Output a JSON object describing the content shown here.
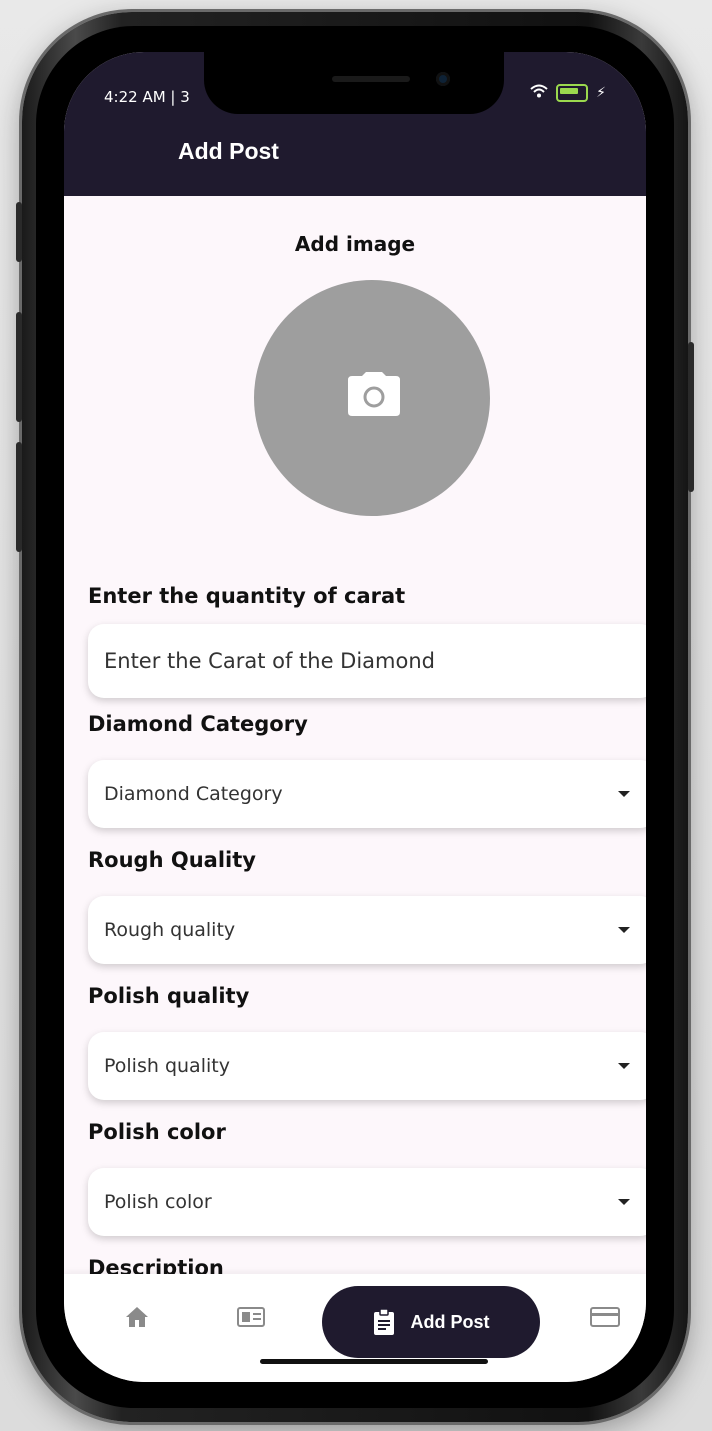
{
  "status_bar": {
    "time": "4:22 AM | 3"
  },
  "app_bar": {
    "title": "Add Post"
  },
  "form": {
    "add_image_label": "Add image",
    "carat": {
      "label": "Enter the quantity of carat",
      "placeholder": "Enter the Carat of the Diamond"
    },
    "category": {
      "label": "Diamond Category",
      "value": "Diamond Category"
    },
    "rough_quality": {
      "label": "Rough Quality",
      "value": "Rough quality"
    },
    "polish_quality": {
      "label": "Polish quality",
      "value": "Polish quality"
    },
    "polish_color": {
      "label": "Polish color",
      "value": "Polish color"
    },
    "description": {
      "label": "Description"
    }
  },
  "bottom_nav": {
    "items": [
      {
        "icon": "home-icon"
      },
      {
        "icon": "id-card-icon"
      },
      {
        "icon": "clipboard-icon",
        "label": "Add Post",
        "active": true
      },
      {
        "icon": "card-icon"
      }
    ]
  },
  "colors": {
    "primary_dark": "#1f1a2e",
    "screen_bg": "#fdf7fb",
    "avatar_gray": "#9e9e9e"
  }
}
